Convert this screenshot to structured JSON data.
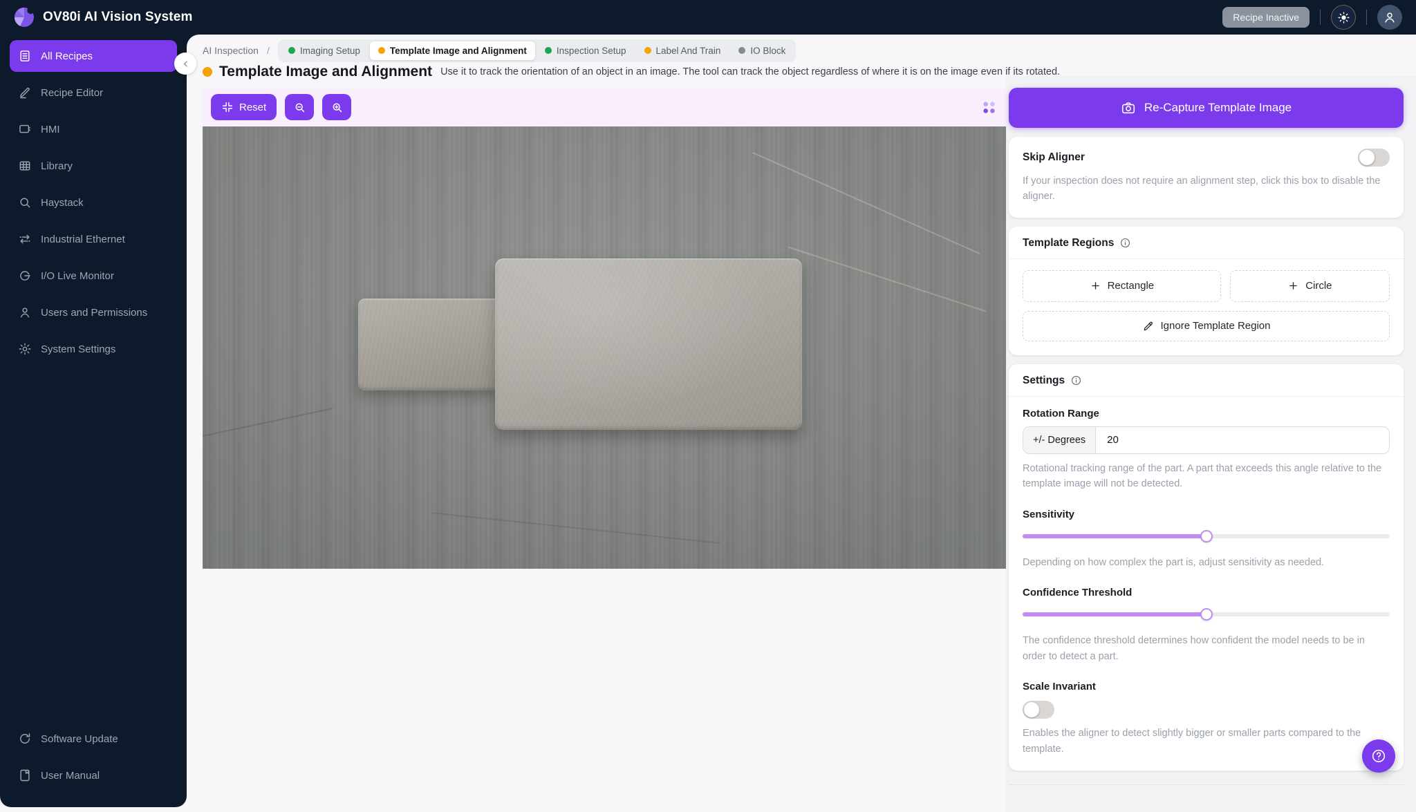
{
  "header": {
    "title": "OV80i AI Vision System",
    "status_badge": "Recipe Inactive"
  },
  "colors": {
    "accent": "#7C3AED",
    "slider": "#C18BF2",
    "toolbar_bg": "#F8EEFC",
    "status_green": "#1BA750",
    "status_orange": "#F5A300",
    "status_gray": "#828A96"
  },
  "sidebar": {
    "items": [
      {
        "label": "All Recipes",
        "icon": "recipes-icon",
        "active": true
      },
      {
        "label": "Recipe Editor",
        "icon": "pencil-icon",
        "active": false
      },
      {
        "label": "HMI",
        "icon": "monitor-icon",
        "active": false
      },
      {
        "label": "Library",
        "icon": "table-icon",
        "active": false
      },
      {
        "label": "Haystack",
        "icon": "search-icon",
        "active": false
      },
      {
        "label": "Industrial Ethernet",
        "icon": "ethernet-icon",
        "active": false
      },
      {
        "label": "I/O Live Monitor",
        "icon": "io-monitor-icon",
        "active": false
      },
      {
        "label": "Users and Permissions",
        "icon": "users-icon",
        "active": false
      },
      {
        "label": "System Settings",
        "icon": "gear-icon",
        "active": false
      }
    ],
    "footer_items": [
      {
        "label": "Software Update",
        "icon": "refresh-icon"
      },
      {
        "label": "User Manual",
        "icon": "book-icon"
      }
    ]
  },
  "breadcrumb": {
    "root": "AI Inspection",
    "separator": "/"
  },
  "tabs": [
    {
      "label": "Imaging Setup",
      "color": "#1BA750",
      "active": false
    },
    {
      "label": "Template Image and Alignment",
      "color": "#F5A300",
      "active": true
    },
    {
      "label": "Inspection Setup",
      "color": "#1BA750",
      "active": false
    },
    {
      "label": "Label And Train",
      "color": "#F5A300",
      "active": false
    },
    {
      "label": "IO Block",
      "color": "#828A96",
      "active": false
    }
  ],
  "page": {
    "title": "Template Image and Alignment",
    "dot_color": "#F5A300",
    "description": "Use it to track the orientation of an object in an image. The tool can track the object regardless of where it is on the image even if its rotated."
  },
  "toolbar": {
    "reset_label": "Reset"
  },
  "panel": {
    "recapture_label": "Re-Capture Template Image",
    "skip_aligner": {
      "label": "Skip Aligner",
      "enabled": false,
      "description": "If your inspection does not require an alignment step, click this box to disable the aligner."
    },
    "template_regions": {
      "title": "Template Regions",
      "rectangle_label": "Rectangle",
      "circle_label": "Circle",
      "ignore_label": "Ignore Template Region"
    },
    "settings": {
      "title": "Settings",
      "rotation_range": {
        "label": "Rotation Range",
        "unit": "+/- Degrees",
        "value": "20",
        "description": "Rotational tracking range of the part. A part that exceeds this angle relative to the template image will not be detected."
      },
      "sensitivity": {
        "label": "Sensitivity",
        "value_pct": 50,
        "description": "Depending on how complex the part is, adjust sensitivity as needed."
      },
      "confidence": {
        "label": "Confidence Threshold",
        "value_pct": 50,
        "description": "The confidence threshold determines how confident the model needs to be in order to detect a part."
      },
      "scale_invariant": {
        "label": "Scale Invariant",
        "enabled": false,
        "description": "Enables the aligner to detect slightly bigger or smaller parts compared to the template."
      }
    }
  }
}
